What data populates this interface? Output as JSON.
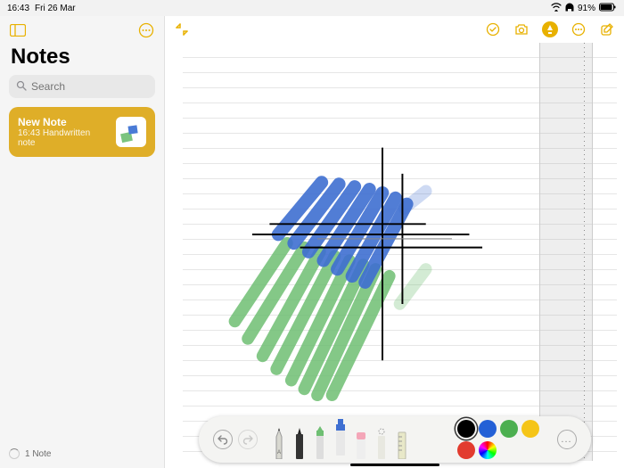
{
  "status": {
    "time": "16:43",
    "date": "Fri 26 Mar",
    "battery": "91%"
  },
  "sidebar": {
    "title": "Notes",
    "search_placeholder": "Search",
    "selected_note": {
      "title": "New Note",
      "subtitle_time": "16:43",
      "subtitle_text": "Handwritten note"
    },
    "footer_count": "1 Note"
  },
  "toolbar": {
    "icons": {
      "sidebar_toggle": "sidebar-icon",
      "more_sidebar": "ellipsis-icon",
      "exit_fullscreen": "contract-icon",
      "checkmark": "check-circle-icon",
      "camera": "camera-icon",
      "markup": "pencil-tip-icon",
      "more": "ellipsis-icon",
      "compose": "compose-icon"
    }
  },
  "palette": {
    "undo": "undo-icon",
    "redo": "redo-icon",
    "tools": [
      {
        "name": "pen",
        "selected": false
      },
      {
        "name": "marker",
        "selected": false
      },
      {
        "name": "highlighter-green",
        "selected": false
      },
      {
        "name": "highlighter-blue",
        "selected": true
      },
      {
        "name": "eraser",
        "selected": false
      },
      {
        "name": "lasso",
        "selected": false
      },
      {
        "name": "ruler",
        "selected": false
      }
    ],
    "colors": [
      {
        "hex": "#000000",
        "selected": true
      },
      {
        "hex": "#2360d6",
        "selected": false
      },
      {
        "hex": "#4caf50",
        "selected": false
      },
      {
        "hex": "#f5c518",
        "selected": false
      },
      {
        "hex": "#e23b2e",
        "selected": false
      },
      {
        "hex": "multicolor",
        "selected": false
      }
    ],
    "more": "..."
  }
}
